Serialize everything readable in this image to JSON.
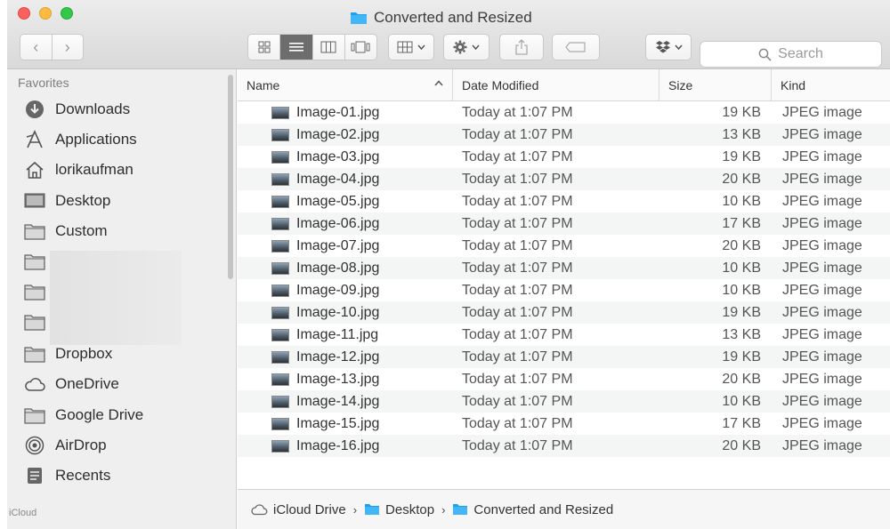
{
  "window": {
    "title": "Converted and Resized"
  },
  "toolbar": {
    "nav_back": "‹",
    "nav_forward": "›",
    "search_placeholder": "Search"
  },
  "sidebar": {
    "header": "Favorites",
    "items": [
      {
        "label": "Downloads",
        "icon": "download-icon"
      },
      {
        "label": "Applications",
        "icon": "applications-icon"
      },
      {
        "label": "lorikaufman",
        "icon": "home-icon"
      },
      {
        "label": "Desktop",
        "icon": "desktop-icon"
      },
      {
        "label": "Custom",
        "icon": "folder-icon"
      },
      {
        "label": "Dropbox",
        "icon": "folder-icon"
      },
      {
        "label": "OneDrive",
        "icon": "cloud-icon"
      },
      {
        "label": "Google Drive",
        "icon": "folder-icon"
      },
      {
        "label": "AirDrop",
        "icon": "airdrop-icon"
      },
      {
        "label": "Recents",
        "icon": "recents-icon"
      }
    ],
    "next_header": "iCloud"
  },
  "columns": {
    "name": "Name",
    "date": "Date Modified",
    "size": "Size",
    "kind": "Kind"
  },
  "files": [
    {
      "name": "Image-01.jpg",
      "date": "Today at 1:07 PM",
      "size": "19 KB",
      "kind": "JPEG image"
    },
    {
      "name": "Image-02.jpg",
      "date": "Today at 1:07 PM",
      "size": "13 KB",
      "kind": "JPEG image"
    },
    {
      "name": "Image-03.jpg",
      "date": "Today at 1:07 PM",
      "size": "19 KB",
      "kind": "JPEG image"
    },
    {
      "name": "Image-04.jpg",
      "date": "Today at 1:07 PM",
      "size": "20 KB",
      "kind": "JPEG image"
    },
    {
      "name": "Image-05.jpg",
      "date": "Today at 1:07 PM",
      "size": "10 KB",
      "kind": "JPEG image"
    },
    {
      "name": "Image-06.jpg",
      "date": "Today at 1:07 PM",
      "size": "17 KB",
      "kind": "JPEG image"
    },
    {
      "name": "Image-07.jpg",
      "date": "Today at 1:07 PM",
      "size": "20 KB",
      "kind": "JPEG image"
    },
    {
      "name": "Image-08.jpg",
      "date": "Today at 1:07 PM",
      "size": "10 KB",
      "kind": "JPEG image"
    },
    {
      "name": "Image-09.jpg",
      "date": "Today at 1:07 PM",
      "size": "10 KB",
      "kind": "JPEG image"
    },
    {
      "name": "Image-10.jpg",
      "date": "Today at 1:07 PM",
      "size": "19 KB",
      "kind": "JPEG image"
    },
    {
      "name": "Image-11.jpg",
      "date": "Today at 1:07 PM",
      "size": "13 KB",
      "kind": "JPEG image"
    },
    {
      "name": "Image-12.jpg",
      "date": "Today at 1:07 PM",
      "size": "19 KB",
      "kind": "JPEG image"
    },
    {
      "name": "Image-13.jpg",
      "date": "Today at 1:07 PM",
      "size": "20 KB",
      "kind": "JPEG image"
    },
    {
      "name": "Image-14.jpg",
      "date": "Today at 1:07 PM",
      "size": "10 KB",
      "kind": "JPEG image"
    },
    {
      "name": "Image-15.jpg",
      "date": "Today at 1:07 PM",
      "size": "17 KB",
      "kind": "JPEG image"
    },
    {
      "name": "Image-16.jpg",
      "date": "Today at 1:07 PM",
      "size": "20 KB",
      "kind": "JPEG image"
    }
  ],
  "pathbar": [
    {
      "label": "iCloud Drive",
      "icon": "cloud-icon"
    },
    {
      "label": "Desktop",
      "icon": "folder-icon"
    },
    {
      "label": "Converted and Resized",
      "icon": "folder-icon"
    }
  ],
  "colors": {
    "folder_blue": "#1aa1f0",
    "selected_view": "#6d6d6d"
  }
}
